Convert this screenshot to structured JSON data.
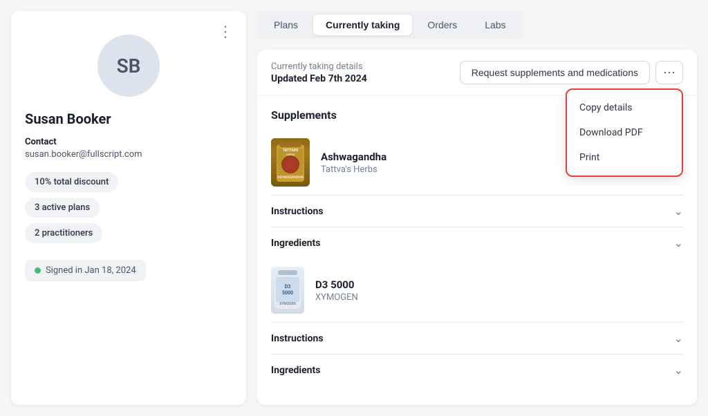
{
  "left_panel": {
    "avatar_initials": "SB",
    "patient_name": "Susan Booker",
    "contact_label": "Contact",
    "contact_email": "susan.booker@fullscript.com",
    "badges": [
      {
        "id": "discount",
        "text": "10% total discount"
      },
      {
        "id": "plans",
        "text": "3 active plans"
      },
      {
        "id": "practitioners",
        "text": "2 practitioners"
      }
    ],
    "signed_label": "Signed in Jan 18, 2024",
    "more_icon": "⋮"
  },
  "tabs": [
    {
      "id": "plans",
      "label": "Plans",
      "active": false
    },
    {
      "id": "currently-taking",
      "label": "Currently taking",
      "active": true
    },
    {
      "id": "orders",
      "label": "Orders",
      "active": false
    },
    {
      "id": "labs",
      "label": "Labs",
      "active": false
    }
  ],
  "content": {
    "header": {
      "details_label": "Currently taking details",
      "updated_label": "Updated Feb 7th 2024",
      "request_btn_label": "Request supplements and medications",
      "more_icon": "⋯"
    },
    "dropdown": {
      "items": [
        {
          "id": "copy",
          "label": "Copy details"
        },
        {
          "id": "download",
          "label": "Download PDF"
        },
        {
          "id": "print",
          "label": "Print"
        }
      ]
    },
    "supplements_section_title": "Supplements",
    "supplements": [
      {
        "id": "ashwagandha",
        "name": "Ashwagandha",
        "brand": "Tattva's Herbs",
        "instructions_label": "Instructions",
        "ingredients_label": "Ingredients",
        "color_top": "#8B6914",
        "color_mid": "#A07820",
        "color_bottom": "#7a5c10",
        "label_text": "TATTVA'S HERBS ASHWAGANDHA"
      },
      {
        "id": "d3-5000",
        "name": "D3 5000",
        "brand": "XYMOGEN",
        "instructions_label": "Instructions",
        "ingredients_label": "Ingredients",
        "color": "#d0dce8"
      }
    ]
  }
}
